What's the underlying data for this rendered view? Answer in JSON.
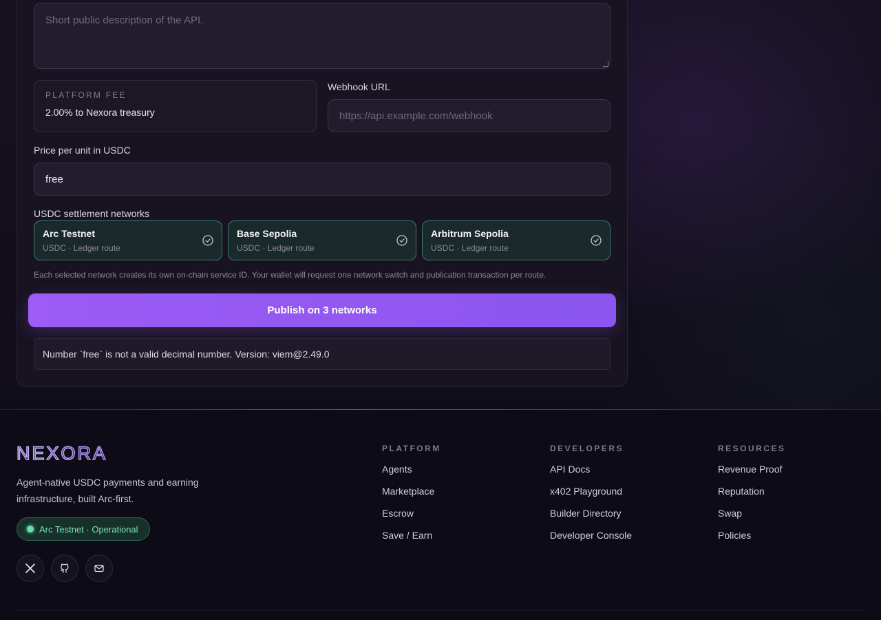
{
  "form": {
    "description_placeholder": "Short public description of the API.",
    "platform_fee": {
      "label": "PLATFORM FEE",
      "value": "2.00% to Nexora treasury"
    },
    "webhook": {
      "label": "Webhook URL",
      "placeholder": "https://api.example.com/webhook"
    },
    "price": {
      "label": "Price per unit in USDC",
      "value": "free"
    },
    "networks_label": "USDC settlement networks",
    "networks": [
      {
        "name": "Arc Testnet",
        "sub": "USDC · Ledger route",
        "selected": true
      },
      {
        "name": "Base Sepolia",
        "sub": "USDC · Ledger route",
        "selected": true
      },
      {
        "name": "Arbitrum Sepolia",
        "sub": "USDC · Ledger route",
        "selected": true
      }
    ],
    "networks_hint": "Each selected network creates its own on-chain service ID. Your wallet will request one network switch and publication transaction per route.",
    "publish_label": "Publish on 3 networks",
    "error_message": "Number `free` is not a valid decimal number. Version: viem@2.49.0"
  },
  "footer": {
    "brand": "NEXORA",
    "tagline": "Agent-native USDC payments and earning infrastructure, built Arc-first.",
    "status": "Arc Testnet · Operational",
    "social": [
      "x-icon",
      "github-icon",
      "mail-icon"
    ],
    "columns": [
      {
        "title": "PLATFORM",
        "links": [
          "Agents",
          "Marketplace",
          "Escrow",
          "Save / Earn"
        ]
      },
      {
        "title": "DEVELOPERS",
        "links": [
          "API Docs",
          "x402 Playground",
          "Builder Directory",
          "Developer Console"
        ]
      },
      {
        "title": "RESOURCES",
        "links": [
          "Revenue Proof",
          "Reputation",
          "Swap",
          "Policies"
        ]
      }
    ]
  },
  "colors": {
    "accent": "#9c5cf5",
    "network_border": "#3d7a6a",
    "status_green": "#5de3b0"
  }
}
